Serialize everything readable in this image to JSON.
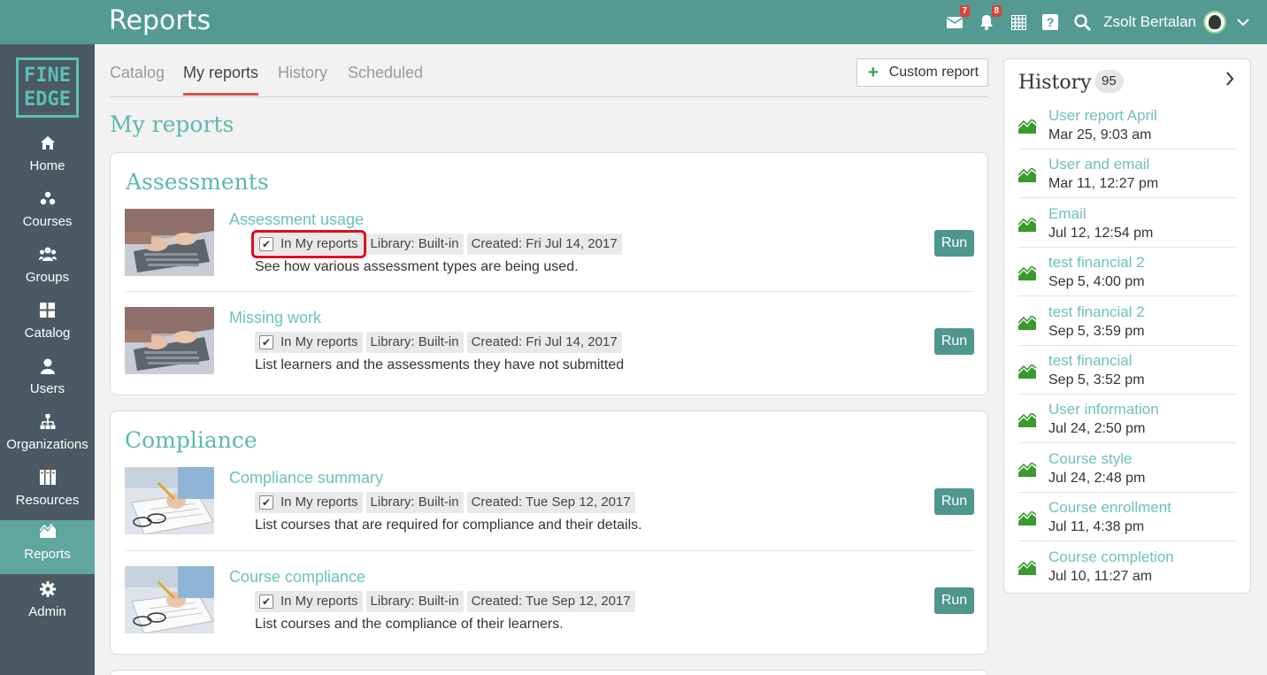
{
  "app": {
    "title": "Reports",
    "mail_badge": "7",
    "bell_badge": "8",
    "user_name": "Zsolt Bertalan"
  },
  "logo": {
    "line1": "FINE",
    "line2": "EDGE"
  },
  "nav": [
    {
      "label": "Home",
      "icon": "home-icon"
    },
    {
      "label": "Courses",
      "icon": "courses-icon"
    },
    {
      "label": "Groups",
      "icon": "groups-icon"
    },
    {
      "label": "Catalog",
      "icon": "catalog-icon"
    },
    {
      "label": "Users",
      "icon": "users-icon"
    },
    {
      "label": "Organizations",
      "icon": "organizations-icon"
    },
    {
      "label": "Resources",
      "icon": "resources-icon"
    },
    {
      "label": "Reports",
      "icon": "reports-icon",
      "active": true
    },
    {
      "label": "Admin",
      "icon": "gear-icon"
    }
  ],
  "tabs": [
    {
      "label": "Catalog"
    },
    {
      "label": "My reports",
      "active": true
    },
    {
      "label": "History"
    },
    {
      "label": "Scheduled"
    }
  ],
  "custom_report_label": "Custom report",
  "section_title": "My reports",
  "categories": [
    {
      "title": "Assessments",
      "reports": [
        {
          "name": "Assessment usage",
          "in_my_reports": "In My reports",
          "library": "Library: Built-in",
          "created": "Created: Fri Jul 14, 2017",
          "description": "See how various assessment types are being used.",
          "run": "Run"
        },
        {
          "name": "Missing work",
          "in_my_reports": "In My reports",
          "library": "Library: Built-in",
          "created": "Created: Fri Jul 14, 2017",
          "description": "List learners and the assessments they have not submitted",
          "run": "Run"
        }
      ]
    },
    {
      "title": "Compliance",
      "reports": [
        {
          "name": "Compliance summary",
          "in_my_reports": "In My reports",
          "library": "Library: Built-in",
          "created": "Created: Tue Sep 12, 2017",
          "description": "List courses that are required for compliance and their details.",
          "run": "Run"
        },
        {
          "name": "Course compliance",
          "in_my_reports": "In My reports",
          "library": "Library: Built-in",
          "created": "Created: Tue Sep 12, 2017",
          "description": "List courses and the compliance of their learners.",
          "run": "Run"
        }
      ]
    }
  ],
  "history": {
    "title": "History",
    "count": "95",
    "items": [
      {
        "name": "User report April",
        "date": "Mar 25, 9:03 am"
      },
      {
        "name": "User and email",
        "date": "Mar 11, 12:27 pm"
      },
      {
        "name": "Email",
        "date": "Jul 12, 12:54 pm"
      },
      {
        "name": "test financial 2",
        "date": "Sep 5, 4:00 pm"
      },
      {
        "name": "test financial 2",
        "date": "Sep 5, 3:59 pm"
      },
      {
        "name": "test financial",
        "date": "Sep 5, 3:52 pm"
      },
      {
        "name": "User information",
        "date": "Jul 24, 2:50 pm"
      },
      {
        "name": "Course style",
        "date": "Jul 24, 2:48 pm"
      },
      {
        "name": "Course enrollment",
        "date": "Jul 11, 4:38 pm"
      },
      {
        "name": "Course completion",
        "date": "Jul 10, 11:27 am"
      }
    ]
  },
  "colors": {
    "brand": "#549a92",
    "accent_text": "#5bb9ad",
    "sidebar": "#4a5963",
    "run_button": "#4f968e",
    "badge": "#d9403a",
    "highlight": "#e3051b"
  }
}
